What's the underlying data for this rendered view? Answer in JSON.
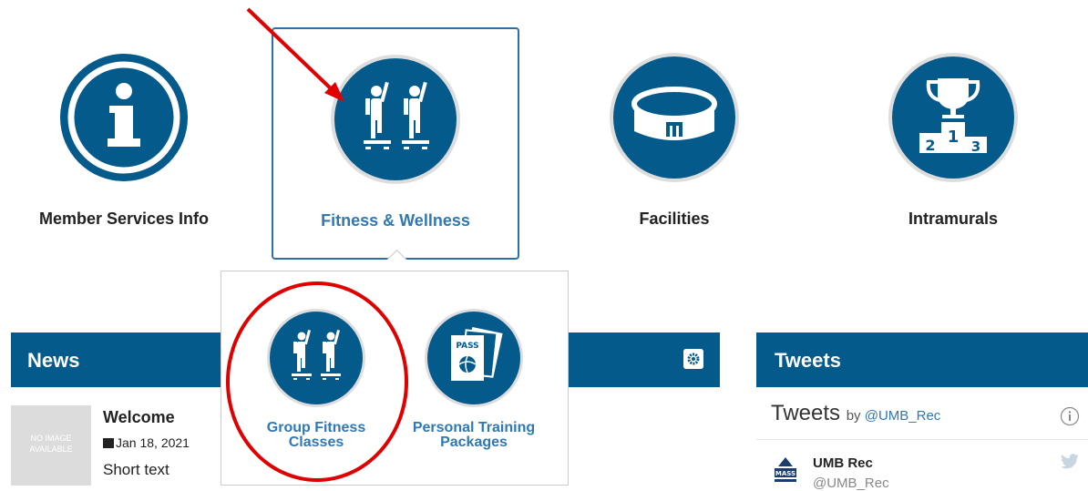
{
  "tiles": [
    {
      "label": "Member Services Info",
      "icon": "info-icon"
    },
    {
      "label": "Fitness & Wellness",
      "icon": "fitness-icon"
    },
    {
      "label": "Facilities",
      "icon": "stadium-icon"
    },
    {
      "label": "Intramurals",
      "icon": "trophy-icon"
    }
  ],
  "dropdown": {
    "items": [
      {
        "label_line1": "Group Fitness",
        "label_line2": "Classes",
        "icon": "fitness-icon"
      },
      {
        "label_line1": "Personal Training",
        "label_line2": "Packages",
        "icon": "pass-icon",
        "badge": "PASS"
      }
    ]
  },
  "news": {
    "title": "News",
    "thumb_line1": "NO IMAGE",
    "thumb_line2": "AVAILABLE",
    "item_title": "Welcome",
    "item_date": "Jan 18, 2021",
    "item_text": "Short text"
  },
  "tweets": {
    "bar_title": "Tweets",
    "widget_title": "Tweets",
    "by": "by",
    "handle": "@UMB_Rec",
    "author_name": "UMB Rec",
    "author_handle": "@UMB_Rec",
    "avatar_text": "MASS"
  },
  "podium": {
    "first": "1",
    "second": "2",
    "third": "3"
  },
  "colors": {
    "brand": "#055a8c",
    "link": "#2f78b4",
    "annotation": "#e00000"
  }
}
